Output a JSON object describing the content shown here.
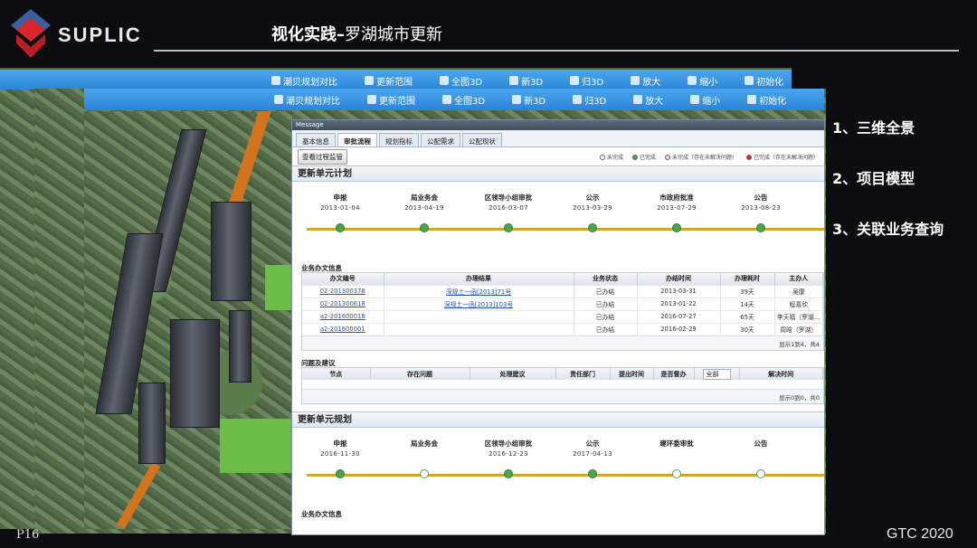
{
  "slide": {
    "brand": "SUPLIC",
    "title_bold": "视化实践–",
    "title_rest": "罗湖城市更新",
    "page": "P16",
    "event": "GTC 2020",
    "points": [
      "1、三维全景",
      "2、项目模型",
      "3、关联业务查询"
    ],
    "colors": {
      "accent": "#2a84d8",
      "logo_red": "#d8262c",
      "logo_blue": "#3a5f9e"
    }
  },
  "toolbar_back": {
    "items": [
      {
        "icon": "compare-icon",
        "label": "潮贝规划对比"
      },
      {
        "icon": "range-icon",
        "label": "更新范围"
      },
      {
        "icon": "globe-icon",
        "label": "全图3D"
      },
      {
        "icon": "new-icon",
        "label": "新3D"
      },
      {
        "icon": "back-icon",
        "label": "归3D"
      },
      {
        "icon": "zoom-in-icon",
        "label": "放大"
      },
      {
        "icon": "zoom-out-icon",
        "label": "缩小"
      },
      {
        "icon": "reset-icon",
        "label": "初始化"
      }
    ]
  },
  "toolbar_front": {
    "items": [
      {
        "icon": "compare-icon",
        "label": "潮贝规划对比"
      },
      {
        "icon": "range-icon",
        "label": "更新范围"
      },
      {
        "icon": "globe-icon",
        "label": "全图3D"
      },
      {
        "icon": "new-icon",
        "label": "新3D"
      },
      {
        "icon": "back-icon",
        "label": "归3D"
      },
      {
        "icon": "zoom-in-icon",
        "label": "放大"
      },
      {
        "icon": "zoom-out-icon",
        "label": "缩小"
      },
      {
        "icon": "reset-icon",
        "label": "初始化"
      }
    ]
  },
  "dialog": {
    "title": "Message",
    "tabs": [
      "基本信息",
      "审批流程",
      "规划指标",
      "公配需求",
      "公配现状"
    ],
    "active_tab": "审批流程",
    "process_button": "查看过程监管",
    "legend": [
      {
        "label": "未完成",
        "color": "#ffffff"
      },
      {
        "label": "已完成",
        "color": "#49a64b"
      },
      {
        "label": "未完成（存在未解决问题）",
        "color": "#f7d7d7"
      },
      {
        "label": "已完成（存在未解决问题）",
        "color": "#d8262c"
      }
    ],
    "plan": {
      "heading": "更新单元计划",
      "steps": [
        {
          "label": "申报",
          "date": "2013-01-04",
          "done": true
        },
        {
          "label": "局业务会",
          "date": "2013-04-19",
          "done": true
        },
        {
          "label": "区领导小组审批",
          "date": "2016-03-07",
          "done": true
        },
        {
          "label": "公示",
          "date": "2013-03-29",
          "done": true
        },
        {
          "label": "市政府批准",
          "date": "2013-07-29",
          "done": true
        },
        {
          "label": "公告",
          "date": "2013-08-23",
          "done": true
        }
      ],
      "doc_heading": "业务办文信息",
      "doc_columns": [
        "办文编号",
        "办理结果",
        "业务状态",
        "办结时间",
        "办理耗时",
        "主办人"
      ],
      "doc_rows": [
        [
          "02-201300378",
          "深规土一函[2013]71号",
          "已办结",
          "2013-03-31",
          "39天",
          "吴康"
        ],
        [
          "02-201300618",
          "深规土一函[2013]103号",
          "已办结",
          "2013-01-22",
          "14天",
          "程喜欣"
        ],
        [
          "a2-201600018",
          "",
          "已办结",
          "2016-07-27",
          "65天",
          "李天福（罗湖…"
        ],
        [
          "a2-201600001",
          "",
          "已办结",
          "2016-02-29",
          "30天",
          "周晗（罗湖）"
        ]
      ],
      "doc_pager": "显示1到4，共4",
      "issue_heading": "问题及建议",
      "issue_columns": [
        "节点",
        "存在问题",
        "处理建议",
        "责任部门",
        "提出时间",
        "是否督办",
        "全部",
        "解决时间"
      ],
      "issue_pager": "显示0到0，共0"
    },
    "planning": {
      "heading": "更新单元规划",
      "steps": [
        {
          "label": "申报",
          "date": "2016-11-30",
          "done": true
        },
        {
          "label": "局业务会",
          "date": "",
          "done": false
        },
        {
          "label": "区领导小组审批",
          "date": "2016-12-23",
          "done": true
        },
        {
          "label": "公示",
          "date": "2017-04-13",
          "done": true
        },
        {
          "label": "建环委审批",
          "date": "",
          "done": false
        },
        {
          "label": "公告",
          "date": "",
          "done": false
        }
      ],
      "doc_heading": "业务办文信息"
    }
  }
}
